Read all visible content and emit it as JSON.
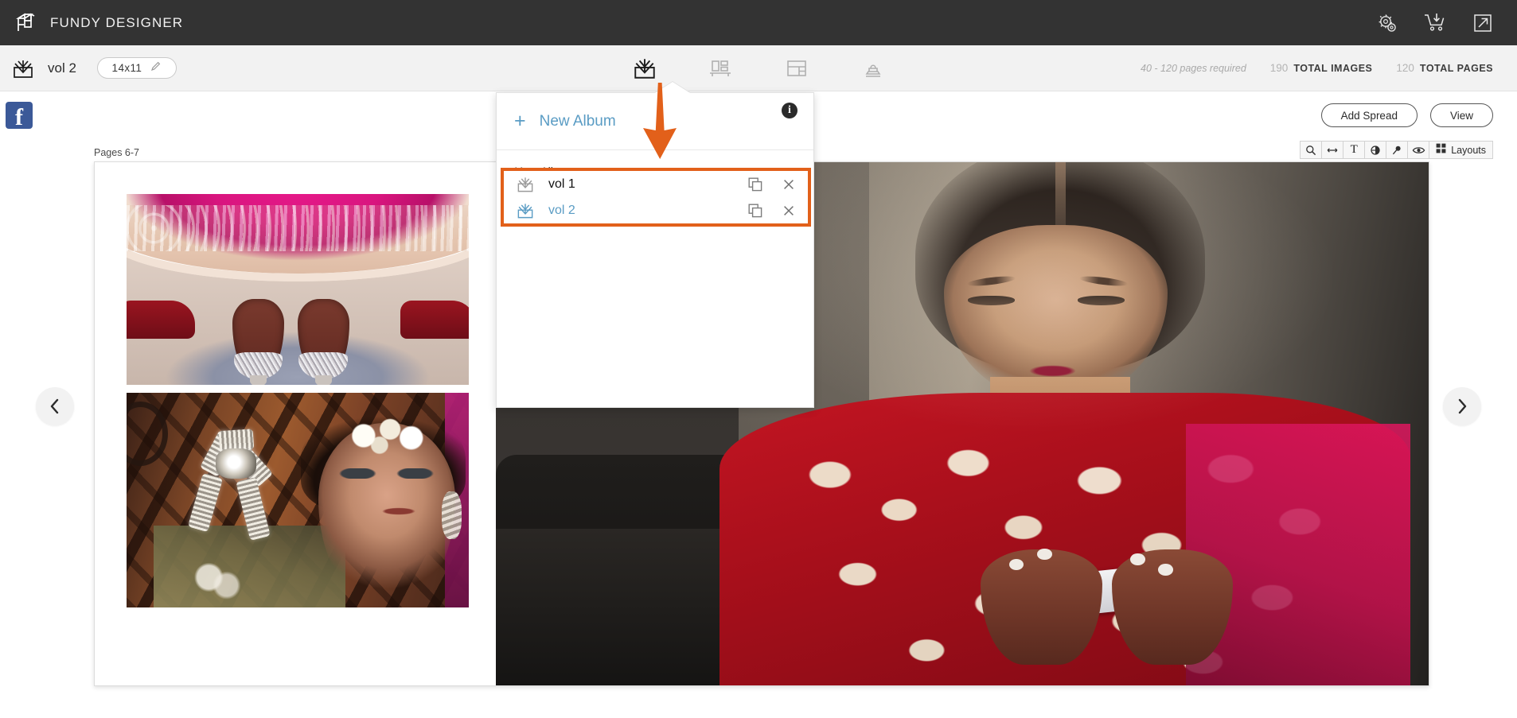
{
  "app": {
    "brand": "FUNDY DESIGNER",
    "logo_icon": "fundy-logo-icon"
  },
  "topbar": {
    "icons": [
      {
        "name": "settings-gear-icon",
        "label": "Settings"
      },
      {
        "name": "cart-download-icon",
        "label": "Cart"
      },
      {
        "name": "external-link-icon",
        "label": "Open External"
      }
    ]
  },
  "subbar": {
    "album_icon": "album-book-icon",
    "album_name": "vol 2",
    "size_value": "14x11",
    "edit_icon": "pencil-icon",
    "tools": [
      {
        "name": "album-tool",
        "icon": "album-book-icon",
        "active": true
      },
      {
        "name": "design-tool",
        "icon": "wall-display-icon",
        "active": false
      },
      {
        "name": "layout-tool",
        "icon": "layout-grid-icon",
        "active": false
      },
      {
        "name": "stamp-tool",
        "icon": "stamp-icon",
        "active": false
      }
    ],
    "pages_required": "40 - 120 pages required",
    "stats": [
      {
        "num": "190",
        "label": "TOTAL IMAGES"
      },
      {
        "num": "120",
        "label": "TOTAL PAGES"
      }
    ]
  },
  "thirdbar": {
    "facebook_icon": "facebook-icon",
    "facebook_letter": "f",
    "add_spread_label": "Add Spread",
    "view_label": "View"
  },
  "canvas_tools": [
    {
      "name": "zoom-icon",
      "label": ""
    },
    {
      "name": "measure-icon",
      "label": ""
    },
    {
      "name": "text-icon",
      "label": "T"
    },
    {
      "name": "contrast-icon",
      "label": ""
    },
    {
      "name": "pin-icon",
      "label": ""
    },
    {
      "name": "eye-icon",
      "label": ""
    },
    {
      "name": "layouts-grid-icon",
      "label": "Layouts"
    }
  ],
  "canvas": {
    "pages_label": "Pages 6-7",
    "prev_icon": "chevron-left-icon",
    "next_icon": "chevron-right-icon",
    "photos": [
      {
        "name": "photo-bridal-feet",
        "alt": "Bride's henna feet in silver shoes under pink and gold lehenga"
      },
      {
        "name": "photo-crystal-brooch",
        "alt": "Crystal starfish brooch with blurred portrait of woman in jeweled headpiece"
      },
      {
        "name": "photo-bride-with-phone",
        "alt": "Bride in red embroidered lehenga looking down at her phone"
      }
    ]
  },
  "dropdown": {
    "new_album_plus": "+",
    "new_album_label": "New Album",
    "info_letter": "i",
    "section_title": "Your Albums",
    "albums": [
      {
        "name": "vol 1",
        "active": false,
        "duplicate_icon": "duplicate-icon",
        "close_icon": "close-icon"
      },
      {
        "name": "vol 2",
        "active": true,
        "duplicate_icon": "duplicate-icon",
        "close_icon": "close-icon"
      }
    ]
  },
  "annotation": {
    "arrow_icon": "orange-down-arrow-annotation",
    "highlight_color": "#e2601a",
    "accent_blue": "#5a9cc4"
  }
}
